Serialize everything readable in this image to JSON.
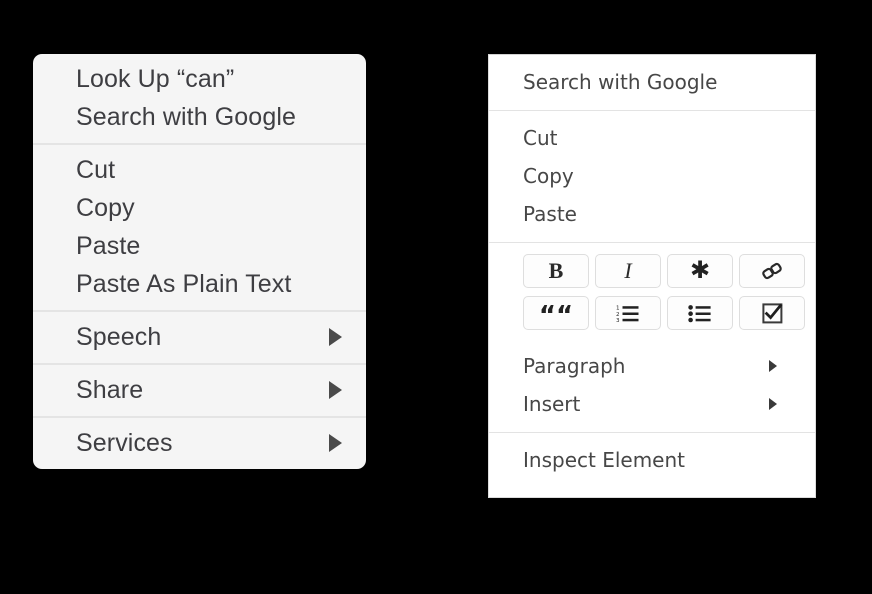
{
  "macos_menu": {
    "groups": [
      {
        "items": [
          {
            "label": "Look Up “can”",
            "has_submenu": false
          },
          {
            "label": "Search with Google",
            "has_submenu": false
          }
        ]
      },
      {
        "items": [
          {
            "label": "Cut",
            "has_submenu": false
          },
          {
            "label": "Copy",
            "has_submenu": false
          },
          {
            "label": "Paste",
            "has_submenu": false
          },
          {
            "label": "Paste As Plain Text",
            "has_submenu": false
          }
        ]
      },
      {
        "items": [
          {
            "label": "Speech",
            "has_submenu": true
          }
        ]
      },
      {
        "items": [
          {
            "label": "Share",
            "has_submenu": true
          }
        ]
      },
      {
        "items": [
          {
            "label": "Services",
            "has_submenu": true
          }
        ]
      }
    ]
  },
  "browser_menu": {
    "search_item": {
      "label": "Search with Google"
    },
    "clipboard_items": [
      {
        "label": "Cut"
      },
      {
        "label": "Copy"
      },
      {
        "label": "Paste"
      }
    ],
    "format_buttons": [
      {
        "icon": "bold-icon",
        "label": "B"
      },
      {
        "icon": "italic-icon",
        "label": "I"
      },
      {
        "icon": "asterisk-icon",
        "label": "✱"
      },
      {
        "icon": "link-icon",
        "label": ""
      },
      {
        "icon": "blockquote-icon",
        "label": "““"
      },
      {
        "icon": "ordered-list-icon",
        "label": ""
      },
      {
        "icon": "bulleted-list-icon",
        "label": ""
      },
      {
        "icon": "checklist-icon",
        "label": ""
      }
    ],
    "submenu_items": [
      {
        "label": "Paragraph",
        "has_submenu": true
      },
      {
        "label": "Insert",
        "has_submenu": true
      }
    ],
    "inspect_item": {
      "label": "Inspect Element"
    }
  },
  "colors": {
    "page_background": "#000000",
    "macos_menu_background": "#f5f5f5",
    "macos_text": "#3e3e42",
    "macos_separator": "#e4e4e4",
    "browser_menu_background": "#ffffff",
    "browser_text": "#474747",
    "browser_border": "#dcdcdc",
    "browser_separator": "#e3e3e3",
    "button_border": "#dedede"
  }
}
